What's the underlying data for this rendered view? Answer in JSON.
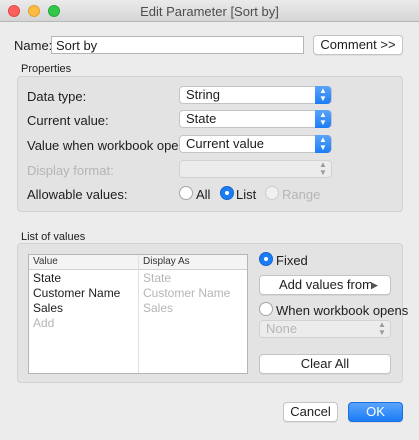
{
  "window": {
    "title": "Edit Parameter [Sort by]"
  },
  "name_row": {
    "label": "Name:",
    "value": "Sort by",
    "comment_button": "Comment >>"
  },
  "properties": {
    "title": "Properties",
    "data_type": {
      "label": "Data type:",
      "value": "String"
    },
    "current_value": {
      "label": "Current value:",
      "value": "State"
    },
    "value_when_opens": {
      "label": "Value when workbook opens:",
      "value": "Current value"
    },
    "display_format": {
      "label": "Display format:",
      "value": ""
    },
    "allowable_values": {
      "label": "Allowable values:",
      "options": [
        "All",
        "List",
        "Range"
      ],
      "selected": "List"
    }
  },
  "list_of_values": {
    "title": "List of values",
    "columns": [
      "Value",
      "Display As"
    ],
    "rows": [
      {
        "value": "State",
        "display_as": "State"
      },
      {
        "value": "Customer Name",
        "display_as": "Customer Name"
      },
      {
        "value": "Sales",
        "display_as": "Sales"
      },
      {
        "value": "Add",
        "display_as": ""
      }
    ],
    "fixed_label": "Fixed",
    "add_values_from_label": "Add values from",
    "add_values_arrow": "▶",
    "when_opens_label": "When workbook opens",
    "when_opens_value": "None",
    "clear_all_label": "Clear All"
  },
  "footer": {
    "cancel": "Cancel",
    "ok": "OK"
  },
  "colors": {
    "accent": "#1b7df5",
    "close": "#fc605c",
    "minimize": "#fdbc40",
    "zoom": "#34c84a"
  }
}
